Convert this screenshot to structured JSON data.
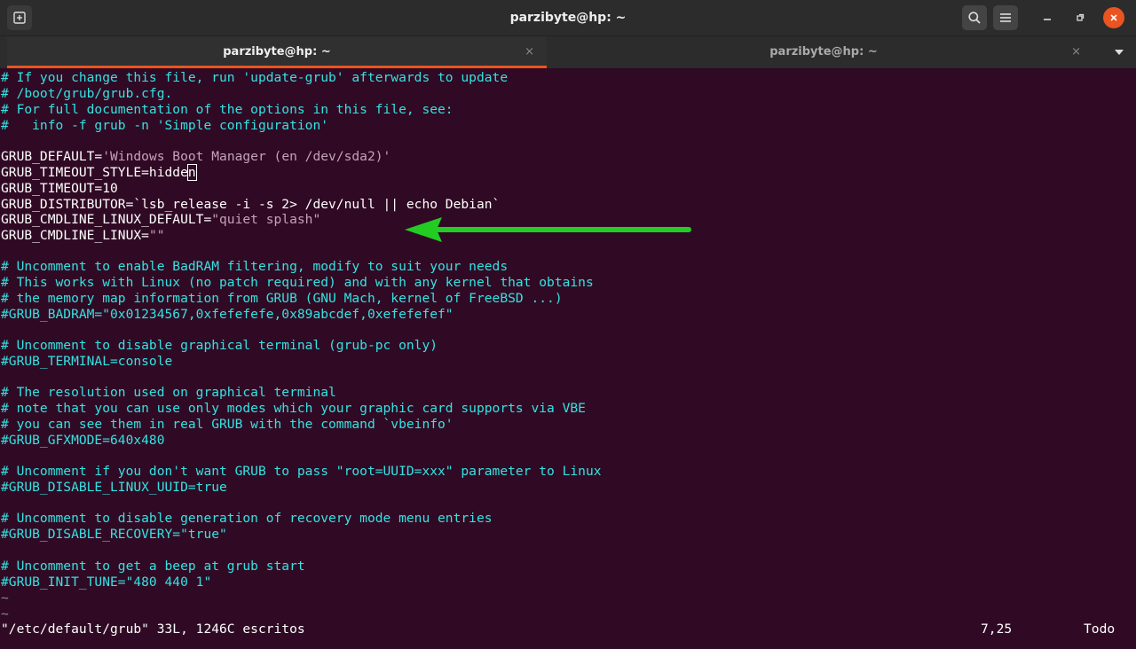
{
  "window": {
    "title": "parzibyte@hp: ~"
  },
  "tabs": [
    {
      "label": "parzibyte@hp: ~",
      "close": "×",
      "active": true
    },
    {
      "label": "parzibyte@hp: ~",
      "close": "×",
      "active": false
    }
  ],
  "icons": {
    "new_tab": "new-tab-icon",
    "search": "search-icon",
    "menu": "hamburger-menu-icon",
    "minimize": "minimize-icon",
    "maximize": "maximize-icon",
    "close": "close-icon",
    "dropdown": "chevron-down-icon",
    "annotation": "green-arrow-icon"
  },
  "colors": {
    "terminal_bg": "#300a24",
    "comment": "#34e2e2",
    "string": "#c4a3b9",
    "close_button": "#e95420",
    "annotation_arrow": "#22cc22"
  },
  "editor": {
    "lines": [
      "# If you change this file, run 'update-grub' afterwards to update",
      "# /boot/grub/grub.cfg.",
      "# For full documentation of the options in this file, see:",
      "#   info -f grub -n 'Simple configuration'",
      "",
      "GRUB_DEFAULT=",
      "GRUB_TIMEOUT_STYLE=hidde",
      "GRUB_TIMEOUT=10",
      "GRUB_DISTRIBUTOR=`lsb_release -i -s 2> /dev/null || echo Debian`",
      "GRUB_CMDLINE_LINUX_DEFAULT=",
      "GRUB_CMDLINE_LINUX=",
      "",
      "# Uncomment to enable BadRAM filtering, modify to suit your needs",
      "# This works with Linux (no patch required) and with any kernel that obtains",
      "# the memory map information from GRUB (GNU Mach, kernel of FreeBSD ...)",
      "#GRUB_BADRAM=\"0x01234567,0xfefefefe,0x89abcdef,0xefefefef\"",
      "",
      "# Uncomment to disable graphical terminal (grub-pc only)",
      "#GRUB_TERMINAL=console",
      "",
      "# The resolution used on graphical terminal",
      "# note that you can use only modes which your graphic card supports via VBE",
      "# you can see them in real GRUB with the command `vbeinfo'",
      "#GRUB_GFXMODE=640x480",
      "",
      "# Uncomment if you don't want GRUB to pass \"root=UUID=xxx\" parameter to Linux",
      "#GRUB_DISABLE_LINUX_UUID=true",
      "",
      "# Uncomment to disable generation of recovery mode menu entries",
      "#GRUB_DISABLE_RECOVERY=\"true\"",
      "",
      "# Uncomment to get a beep at grub start",
      "#GRUB_INIT_TUNE=\"480 440 1\"",
      "~",
      "~"
    ],
    "grub_default_value": "'Windows Boot Manager (en /dev/sda2)'",
    "cursor_char": "n",
    "cmdline_default_value": "\"quiet splash\"",
    "cmdline_value": "\"\""
  },
  "status": {
    "file_info": "\"/etc/default/grub\" 33L, 1246C escritos",
    "position": "7,25",
    "scroll": "Todo"
  }
}
